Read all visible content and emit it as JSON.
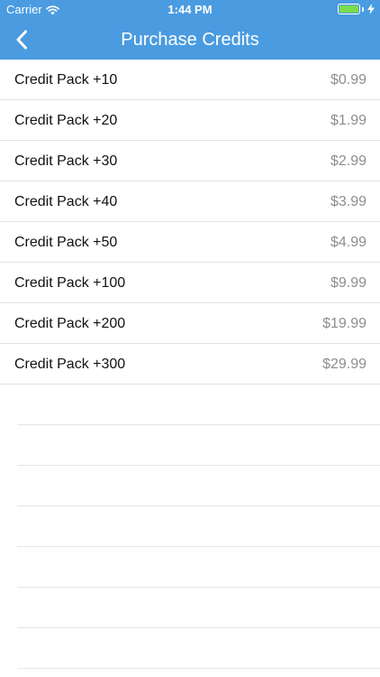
{
  "status_bar": {
    "carrier": "Carrier",
    "time": "1:44 PM",
    "wifi_icon": "wifi-icon",
    "battery_icon": "battery-icon",
    "charging_icon": "bolt-icon"
  },
  "nav": {
    "back_icon": "chevron-left-icon",
    "title": "Purchase Credits"
  },
  "colors": {
    "header_bg": "#4a9be0",
    "price_text": "#8e8e93",
    "battery_fill": "#7bdc4f"
  },
  "credit_packs": [
    {
      "name": "Credit Pack +10",
      "price": "$0.99"
    },
    {
      "name": "Credit Pack +20",
      "price": "$1.99"
    },
    {
      "name": "Credit Pack +30",
      "price": "$2.99"
    },
    {
      "name": "Credit Pack +40",
      "price": "$3.99"
    },
    {
      "name": "Credit Pack +50",
      "price": "$4.99"
    },
    {
      "name": "Credit Pack +100",
      "price": "$9.99"
    },
    {
      "name": "Credit Pack +200",
      "price": "$19.99"
    },
    {
      "name": "Credit Pack +300",
      "price": "$29.99"
    }
  ]
}
